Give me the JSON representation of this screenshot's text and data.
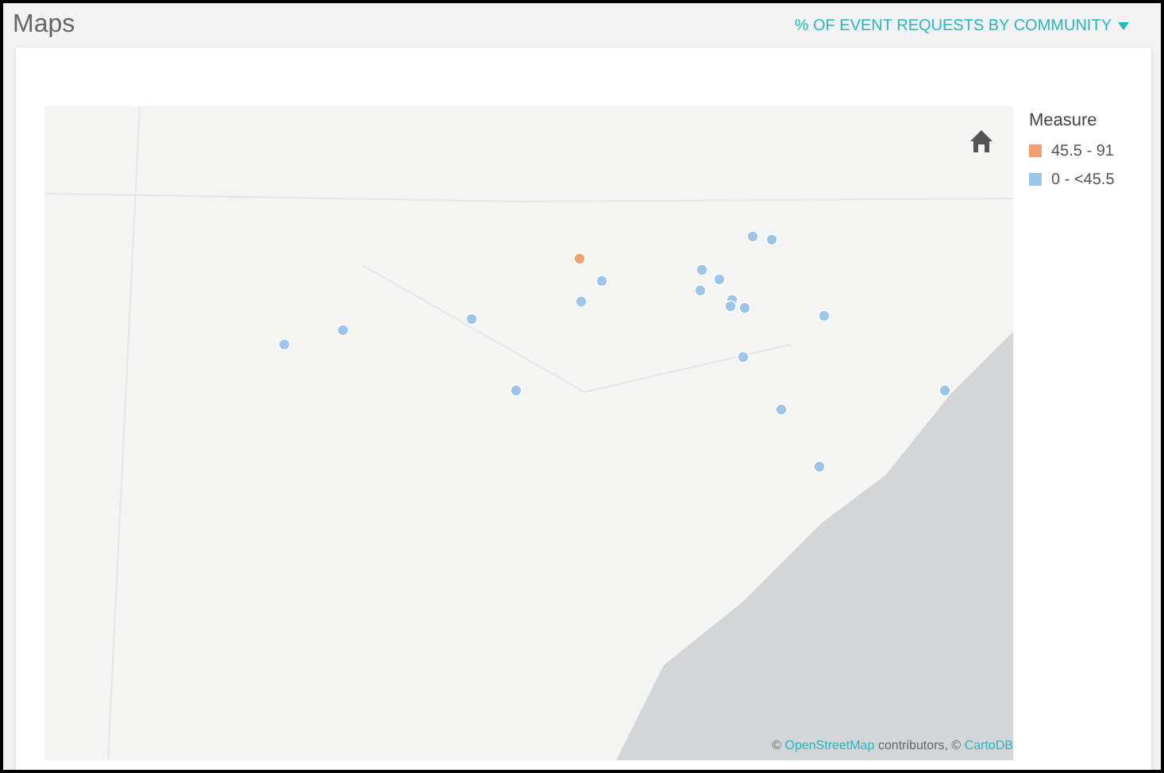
{
  "page_title": "Maps",
  "measure_dropdown": {
    "label": "% OF EVENT REQUESTS BY COMMUNITY"
  },
  "legend": {
    "title": "Measure",
    "items": [
      {
        "label": "45.5 - 91",
        "color": "#f0a070"
      },
      {
        "label": "0 - <45.5",
        "color": "#9cc5ea"
      }
    ]
  },
  "markers": [
    {
      "color": "#f0a070"
    },
    {
      "color": "#9cc5ea"
    },
    {
      "color": "#9cc5ea"
    },
    {
      "color": "#9cc5ea"
    },
    {
      "color": "#9cc5ea"
    },
    {
      "color": "#9cc5ea"
    },
    {
      "color": "#9cc5ea"
    },
    {
      "color": "#9cc5ea"
    },
    {
      "color": "#9cc5ea"
    },
    {
      "color": "#9cc5ea"
    },
    {
      "color": "#9cc5ea"
    },
    {
      "color": "#9cc5ea"
    },
    {
      "color": "#9cc5ea"
    },
    {
      "color": "#9cc5ea"
    },
    {
      "color": "#9cc5ea"
    },
    {
      "color": "#9cc5ea"
    },
    {
      "color": "#9cc5ea"
    },
    {
      "color": "#9cc5ea"
    },
    {
      "color": "#9cc5ea"
    },
    {
      "color": "#9cc5ea"
    }
  ],
  "attribution": {
    "prefix": "©",
    "link_1": "OpenStreetMap",
    "middle": "contributors, ©",
    "link_2": "CartoDB"
  }
}
